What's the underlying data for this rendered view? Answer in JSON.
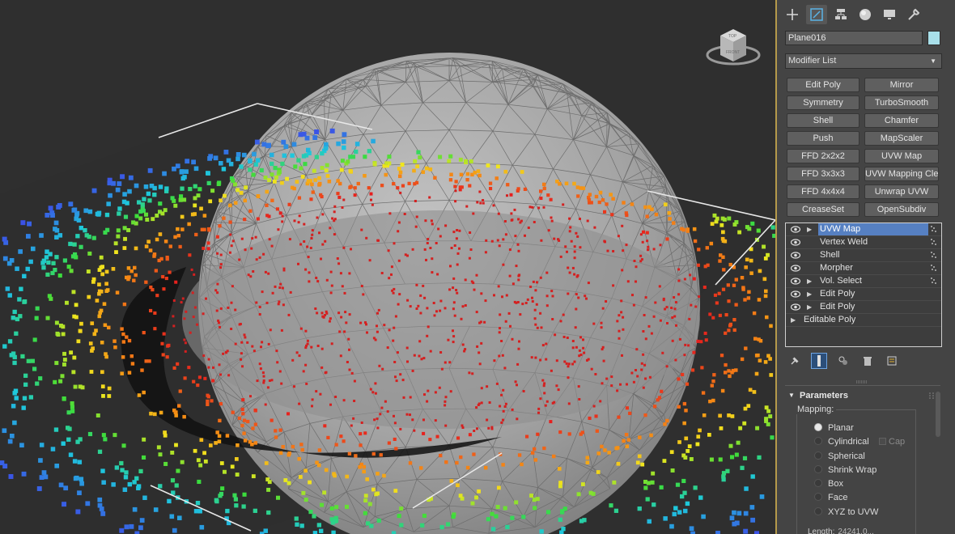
{
  "viewport": {
    "viewcube_top": "TOP",
    "viewcube_side": "FRONT"
  },
  "command_panel": {
    "tabs": [
      {
        "name": "create",
        "icon": "plus-icon"
      },
      {
        "name": "modify",
        "icon": "modify-icon"
      },
      {
        "name": "hierarchy",
        "icon": "hierarchy-icon"
      },
      {
        "name": "motion",
        "icon": "motion-icon"
      },
      {
        "name": "display",
        "icon": "display-icon"
      },
      {
        "name": "utilities",
        "icon": "wrench-icon"
      }
    ],
    "object_name": "Plane016",
    "object_color": "#a8dfe9",
    "modifier_list": "Modifier List",
    "modifier_buttons": [
      "Edit Poly",
      "Mirror",
      "Symmetry",
      "TurboSmooth",
      "Shell",
      "Chamfer",
      "Push",
      "MapScaler",
      "FFD 2x2x2",
      "UVW Map",
      "FFD 3x3x3",
      "UVW Mapping Clear",
      "FFD 4x4x4",
      "Unwrap UVW",
      "CreaseSet",
      "OpenSubdiv"
    ],
    "stack": [
      {
        "label": "UVW Map",
        "expandable": true,
        "selected": true,
        "dots": true
      },
      {
        "label": "Vertex Weld",
        "expandable": false,
        "selected": false,
        "dots": true
      },
      {
        "label": "Shell",
        "expandable": false,
        "selected": false,
        "dots": true
      },
      {
        "label": "Morpher",
        "expandable": false,
        "selected": false,
        "dots": true
      },
      {
        "label": "Vol. Select",
        "expandable": true,
        "selected": false,
        "dots": true
      },
      {
        "label": "Edit Poly",
        "expandable": true,
        "selected": false,
        "dots": false
      },
      {
        "label": "Edit Poly",
        "expandable": true,
        "selected": false,
        "dots": false
      }
    ],
    "base_object": "Editable Poly",
    "parameters": {
      "title": "Parameters",
      "mapping_label": "Mapping:",
      "options": [
        "Planar",
        "Cylindrical",
        "Spherical",
        "Shrink Wrap",
        "Box",
        "Face",
        "XYZ to UVW"
      ],
      "selected": "Planar",
      "cap_label": "Cap",
      "length_label": "Length:",
      "length_value": "24241.0..."
    }
  }
}
